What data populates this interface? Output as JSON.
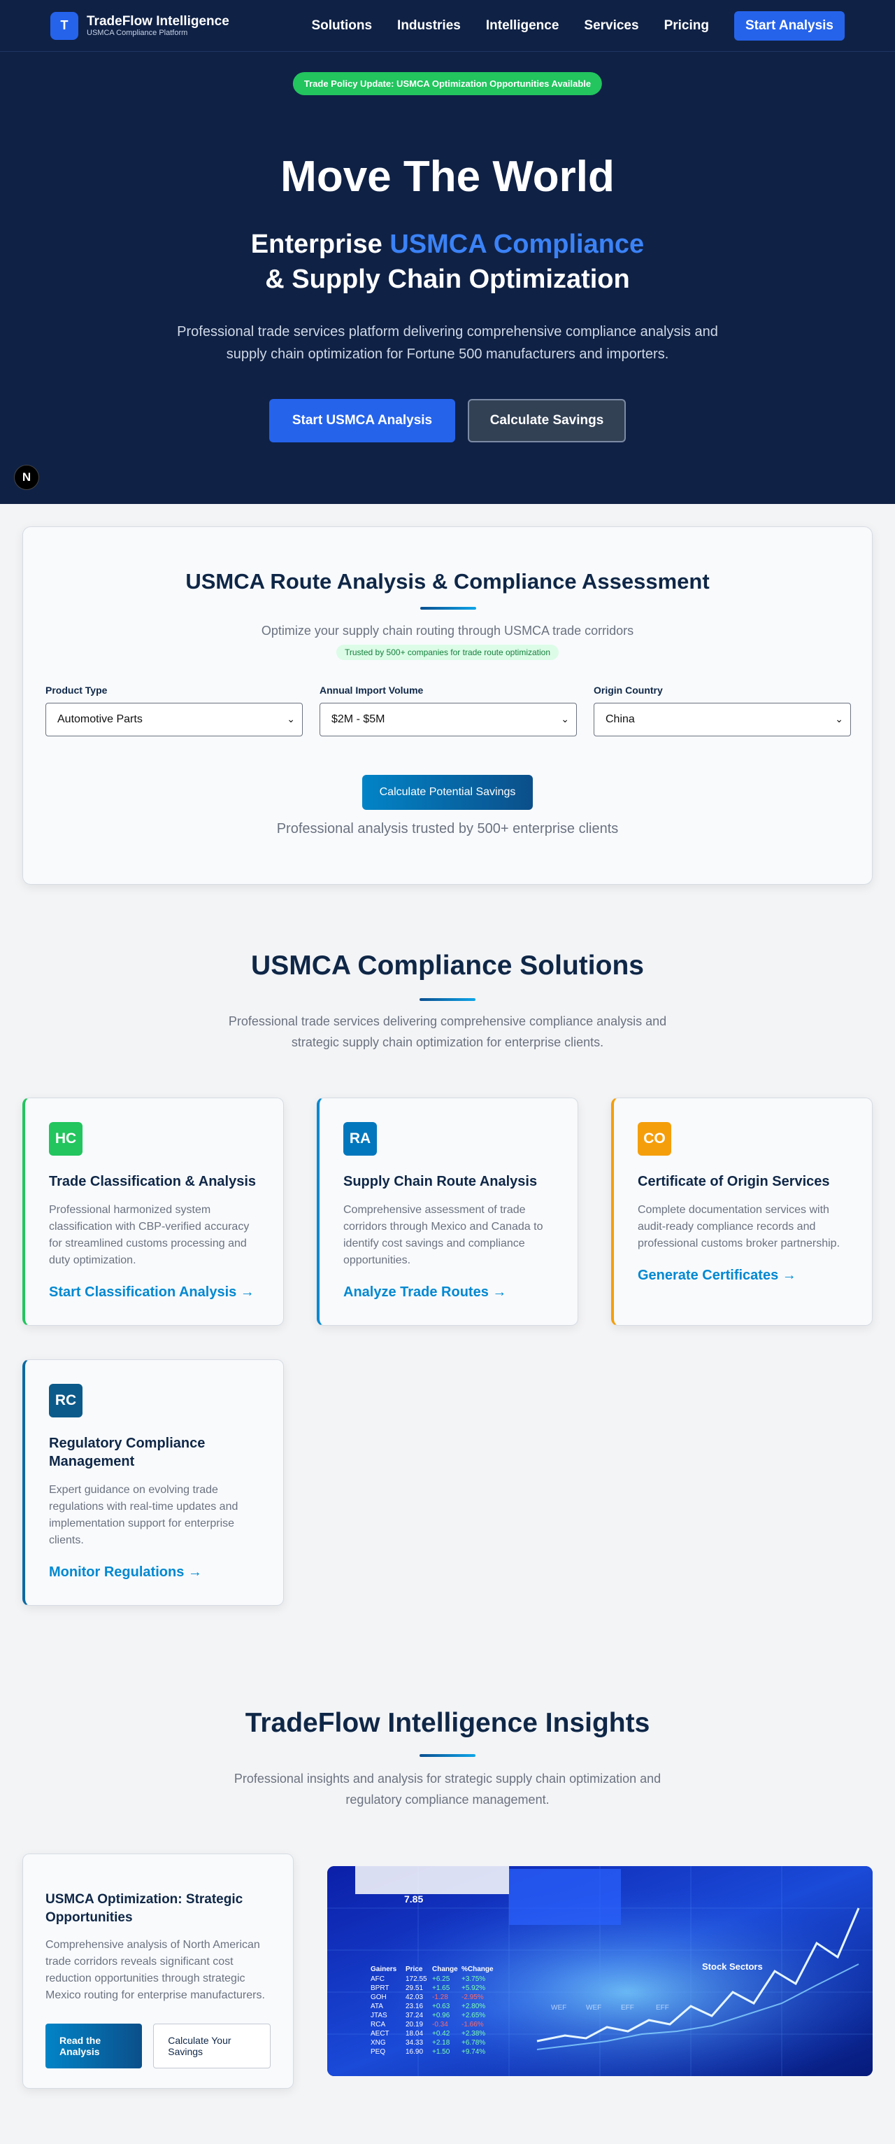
{
  "brand": {
    "logo_letter": "T",
    "name": "TradeFlow Intelligence",
    "tagline": "USMCA Compliance Platform"
  },
  "nav": {
    "links": [
      "Solutions",
      "Industries",
      "Intelligence",
      "Services",
      "Pricing"
    ],
    "cta": "Start Analysis"
  },
  "hero": {
    "badge": "Trade Policy Update: USMCA Optimization Opportunities Available",
    "title": "Move The World",
    "subtitle_prefix": "Enterprise ",
    "subtitle_accent": "USMCA Compliance",
    "subtitle_line2": "& Supply Chain Optimization",
    "description": "Professional trade services platform delivering comprehensive compliance analysis and supply chain optimization for Fortune 500 manufacturers and importers.",
    "primary_button": "Start USMCA Analysis",
    "secondary_button": "Calculate Savings",
    "floating_icon": "N"
  },
  "analysis": {
    "title": "USMCA Route Analysis & Compliance Assessment",
    "subtitle": "Optimize your supply chain routing through USMCA trade corridors",
    "trust_badge": "Trusted by 500+ companies for trade route optimization",
    "fields": [
      {
        "label": "Product Type",
        "value": "Automotive Parts"
      },
      {
        "label": "Annual Import Volume",
        "value": "$2M - $5M"
      },
      {
        "label": "Origin Country",
        "value": "China"
      }
    ],
    "button": "Calculate Potential Savings",
    "footer": "Professional analysis trusted by 500+ enterprise clients"
  },
  "solutions": {
    "title": "USMCA Compliance Solutions",
    "subtitle": "Professional trade services delivering comprehensive compliance analysis and strategic supply chain optimization for enterprise clients.",
    "cards": [
      {
        "abbr": "HC",
        "title": "Trade Classification & Analysis",
        "text": "Professional harmonized system classification with CBP-verified accuracy for streamlined customs processing and duty optimization.",
        "link": "Start Classification Analysis →",
        "color": "#22c55e",
        "border": "#22c55e"
      },
      {
        "abbr": "RA",
        "title": "Supply Chain Route Analysis",
        "text": "Comprehensive assessment of trade corridors through Mexico and Canada to identify cost savings and compliance opportunities.",
        "link": "Analyze Trade Routes →",
        "color": "#0277bd",
        "border": "#0288d1"
      },
      {
        "abbr": "CO",
        "title": "Certificate of Origin Services",
        "text": "Complete documentation services with audit-ready compliance records and professional customs broker partnership.",
        "link": "Generate Certificates →",
        "color": "#f59e0b",
        "border": "#f59e0b"
      },
      {
        "abbr": "RC",
        "title": "Regulatory Compliance Management",
        "text": "Expert guidance on evolving trade regulations with real-time updates and implementation support for enterprise clients.",
        "link": "Monitor Regulations →",
        "color": "#0b5a8a",
        "border": "#0b6aa2"
      }
    ]
  },
  "insights": {
    "title": "TradeFlow Intelligence Insights",
    "subtitle": "Professional insights and analysis for strategic supply chain optimization and regulatory compliance management.",
    "card": {
      "title": "USMCA Optimization: Strategic Opportunities",
      "text": "Comprehensive analysis of North American trade corridors reveals significant cost reduction opportunities through strategic Mexico routing for enterprise manufacturers.",
      "read_button": "Read the Analysis",
      "calc_button": "Calculate Your Savings"
    },
    "image": {
      "big_number": "7.85",
      "sectors_label": "Stock Sectors",
      "ticker_header": [
        "Gainers",
        "Price",
        "Change",
        "%Change"
      ],
      "tickers": [
        {
          "sym": "AFC",
          "price": "172.55",
          "chg": "+6.25",
          "pct": "+3.75%"
        },
        {
          "sym": "BPRT",
          "price": "29.51",
          "chg": "+1.65",
          "pct": "+5.92%"
        },
        {
          "sym": "GOH",
          "price": "42.03",
          "chg": "-1.28",
          "pct": "-2.95%"
        },
        {
          "sym": "ATA",
          "price": "23.16",
          "chg": "+0.63",
          "pct": "+2.80%"
        },
        {
          "sym": "JTAS",
          "price": "37.24",
          "chg": "+0.96",
          "pct": "+2.65%"
        },
        {
          "sym": "RCA",
          "price": "20.19",
          "chg": "-0.34",
          "pct": "-1.66%"
        },
        {
          "sym": "AECT",
          "price": "18.04",
          "chg": "+0.42",
          "pct": "+2.38%"
        },
        {
          "sym": "XNG",
          "price": "34.33",
          "chg": "+2.18",
          "pct": "+6.78%"
        },
        {
          "sym": "PEQ",
          "price": "16.90",
          "chg": "+1.50",
          "pct": "+9.74%"
        }
      ],
      "wef_labels": [
        "WEF",
        "WEF",
        "EFF",
        "EFF"
      ]
    }
  }
}
